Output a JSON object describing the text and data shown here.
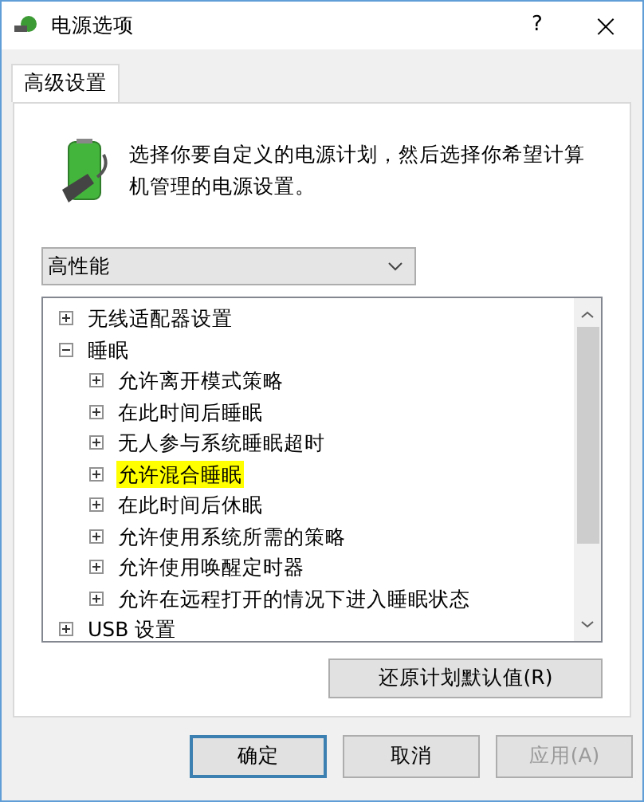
{
  "window": {
    "title": "电源选项",
    "help": "?",
    "close": "×"
  },
  "tabs": [
    {
      "label": "高级设置",
      "selected": true
    }
  ],
  "description": "选择你要自定义的电源计划，然后选择你希望计算机管理的电源设置。",
  "plan_dropdown": {
    "value": "高性能"
  },
  "tree": [
    {
      "label": "无线适配器设置",
      "expanded": false,
      "selected": false
    },
    {
      "label": "睡眠",
      "expanded": true,
      "selected": false,
      "children": [
        {
          "label": "允许离开模式策略",
          "expanded": false,
          "selected": false
        },
        {
          "label": "在此时间后睡眠",
          "expanded": false,
          "selected": false
        },
        {
          "label": "无人参与系统睡眠超时",
          "expanded": false,
          "selected": false
        },
        {
          "label": "允许混合睡眠",
          "expanded": false,
          "selected": true
        },
        {
          "label": "在此时间后休眠",
          "expanded": false,
          "selected": false
        },
        {
          "label": "允许使用系统所需的策略",
          "expanded": false,
          "selected": false
        },
        {
          "label": "允许使用唤醒定时器",
          "expanded": false,
          "selected": false
        },
        {
          "label": "允许在远程打开的情况下进入睡眠状态",
          "expanded": false,
          "selected": false
        }
      ]
    },
    {
      "label": "USB 设置",
      "expanded": false,
      "selected": false
    }
  ],
  "restore_button": "还原计划默认值(R)",
  "buttons": [
    {
      "label": "确定",
      "kind": "default",
      "disabled": false
    },
    {
      "label": "取消",
      "kind": "normal",
      "disabled": false
    },
    {
      "label": "应用(A)",
      "kind": "normal",
      "disabled": true
    }
  ]
}
